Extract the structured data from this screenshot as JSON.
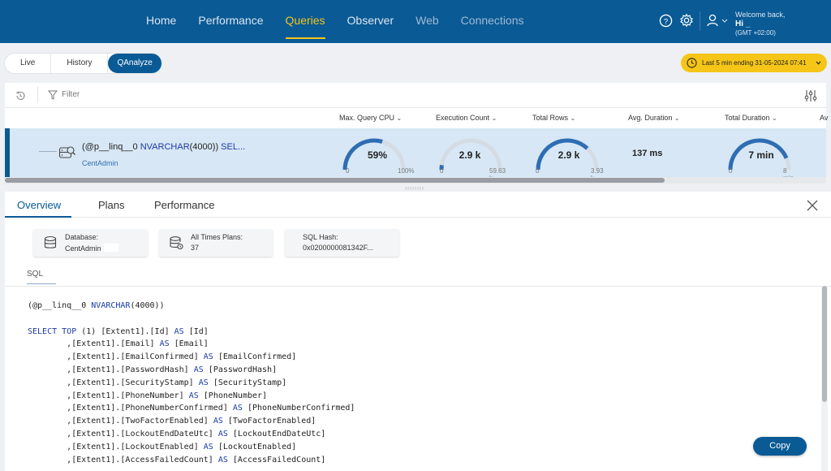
{
  "nav": {
    "items": [
      "Home",
      "Performance",
      "Queries",
      "Observer",
      "Web",
      "Connections"
    ],
    "active": "Queries",
    "welcome": "Welcome back,",
    "user": "Hi _",
    "timezone": "(GMT +02:00)"
  },
  "segments": [
    "Live",
    "History",
    "QAnalyze"
  ],
  "active_segment": "QAnalyze",
  "time_range": "Last 5 min ending  31-05-2024 07:41",
  "toolbar": {
    "filter_label": "Filter"
  },
  "columns": [
    "Max. Query CPU",
    "Execution Count",
    "Total Rows",
    "Avg. Duration",
    "Total Duration",
    "Av"
  ],
  "query_row": {
    "text_prefix": "(@p__linq__0 ",
    "text_kw": "NVARCHAR",
    "text_mid": "(4000)) ",
    "text_kw2": "SEL...",
    "database": "CentAdmin",
    "max_cpu": {
      "value": "59%",
      "min": "0",
      "max": "100%",
      "fraction": 0.59
    },
    "execution_count": {
      "value": "2.9 k",
      "min": "0",
      "max": "59.63 k",
      "fraction": 0.05
    },
    "total_rows": {
      "value": "2.9 k",
      "min": "0",
      "max": "3.93 k",
      "fraction": 0.74
    },
    "avg_duration": "137 ms",
    "total_duration": {
      "value": "7 min",
      "min": "0",
      "max": "8 min",
      "fraction": 0.87
    }
  },
  "tabs": [
    "Overview",
    "Plans",
    "Performance"
  ],
  "active_tab": "Overview",
  "cards": {
    "database": {
      "label": "Database:",
      "value": "CentAdmin"
    },
    "plans": {
      "label": "All Times Plans:",
      "value": "37"
    },
    "hash": {
      "label": "SQL Hash:",
      "value": "0x0200000081342F..."
    }
  },
  "sql_tab": "SQL",
  "sql": {
    "decl_prefix": "(@p__linq__0 ",
    "decl_kw": "NVARCHAR",
    "decl_suffix": "(4000))",
    "select_line": {
      "kw1": "SELECT",
      "kw2": "TOP",
      "rest": " (1) [Extent1].[Id] ",
      "kw3": "AS",
      "tail": " [Id]"
    },
    "columns": [
      {
        "src": ",[Extent1].[Email]",
        "alias": "[Email]"
      },
      {
        "src": ",[Extent1].[EmailConfirmed]",
        "alias": "[EmailConfirmed]"
      },
      {
        "src": ",[Extent1].[PasswordHash]",
        "alias": "[PasswordHash]"
      },
      {
        "src": ",[Extent1].[SecurityStamp]",
        "alias": "[SecurityStamp]"
      },
      {
        "src": ",[Extent1].[PhoneNumber]",
        "alias": "[PhoneNumber]"
      },
      {
        "src": ",[Extent1].[PhoneNumberConfirmed]",
        "alias": "[PhoneNumberConfirmed]"
      },
      {
        "src": ",[Extent1].[TwoFactorEnabled]",
        "alias": "[TwoFactorEnabled]"
      },
      {
        "src": ",[Extent1].[LockoutEndDateUtc]",
        "alias": "[LockoutEndDateUtc]"
      },
      {
        "src": ",[Extent1].[LockoutEnabled]",
        "alias": "[LockoutEnabled]"
      },
      {
        "src": ",[Extent1].[AccessFailedCount]",
        "alias": "[AccessFailedCount]"
      }
    ],
    "as_kw": "AS"
  },
  "copy_label": "Copy",
  "colors": {
    "primary": "#0a5a95",
    "accent": "#f3c51b",
    "gauge": "#2e6db3",
    "gauge_track": "#e3e6ea"
  }
}
